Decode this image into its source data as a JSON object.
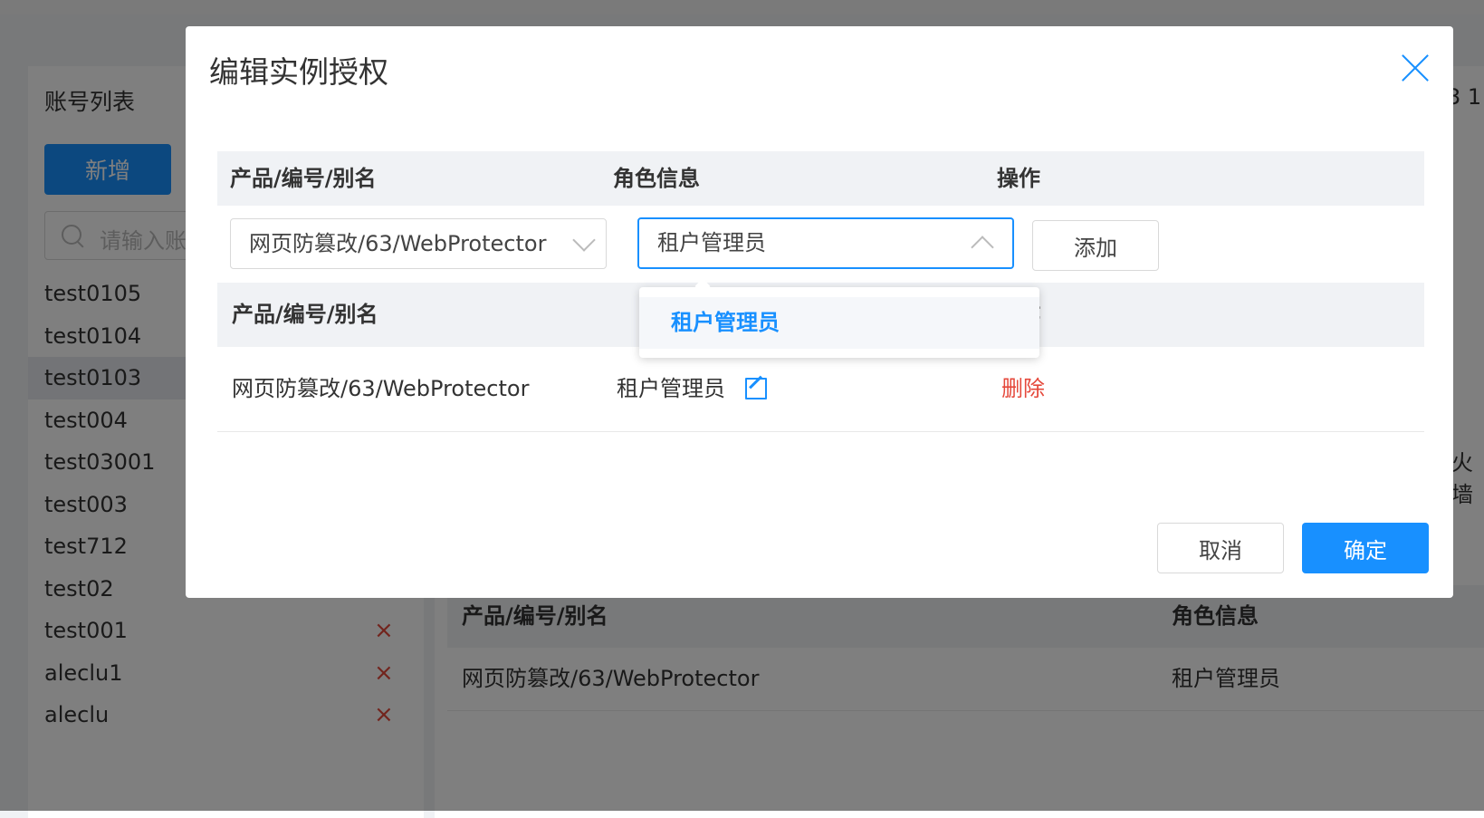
{
  "background": {
    "account_panel": {
      "title": "账号列表",
      "add_button": "新增",
      "search_placeholder": "请输入账",
      "accounts": [
        {
          "name": "test0105"
        },
        {
          "name": "test0104"
        },
        {
          "name": "test0103",
          "selected": true
        },
        {
          "name": "test004"
        },
        {
          "name": "test03001"
        },
        {
          "name": "test003"
        },
        {
          "name": "test712"
        },
        {
          "name": "test02"
        },
        {
          "name": "test001",
          "delete": "×"
        },
        {
          "name": "aleclu1",
          "delete": "×"
        },
        {
          "name": "aleclu",
          "delete": "×"
        }
      ]
    },
    "right_panel": {
      "partial_text_top": "3 1",
      "partial_text_mid": "火墙",
      "table_headers": {
        "product": "产品/编号/别名",
        "role": "角色信息"
      },
      "table_row": {
        "product": "网页防篡改/63/WebProtector",
        "role": "租户管理员"
      }
    }
  },
  "modal": {
    "title": "编辑实例授权",
    "header": {
      "product": "产品/编号/别名",
      "role": "角色信息",
      "action": "操作"
    },
    "product_select_value": "网页防篡改/63/WebProtector",
    "role_select_value": "租户管理员",
    "add_button": "添加",
    "dropdown_options": [
      "租户管理员"
    ],
    "table_headers": {
      "product": "产品/编号/别名",
      "action": "操作"
    },
    "rows": [
      {
        "product": "网页防篡改/63/WebProtector",
        "role": "租户管理员",
        "action": "删除"
      }
    ],
    "cancel_button": "取消",
    "confirm_button": "确定"
  },
  "colors": {
    "primary": "#1890ff",
    "danger": "#e5483b",
    "header_bg": "#f0f2f5"
  }
}
